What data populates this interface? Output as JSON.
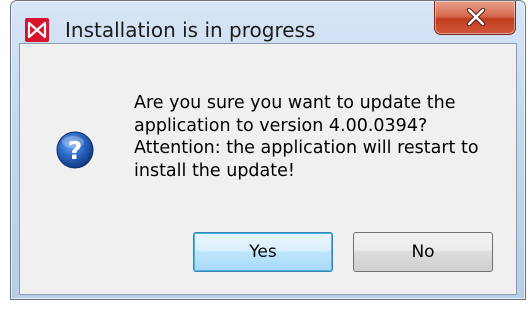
{
  "window": {
    "title": "Installation is in progress",
    "close_icon": "close-x-icon",
    "logo_icon": "app-logo-icon"
  },
  "dialog": {
    "icon": "question-icon",
    "message_lines": [
      "Are you sure you want to update the",
      "application to version 4.00.0394?",
      "Attention: the application will restart to",
      "install the update!"
    ],
    "buttons": {
      "yes_label": "Yes",
      "no_label": "No"
    }
  },
  "colors": {
    "logo_red": "#d6142e",
    "close_red": "#c03d1f",
    "question_blue": "#1f5fb5",
    "default_button_border": "#3c7fb1"
  }
}
